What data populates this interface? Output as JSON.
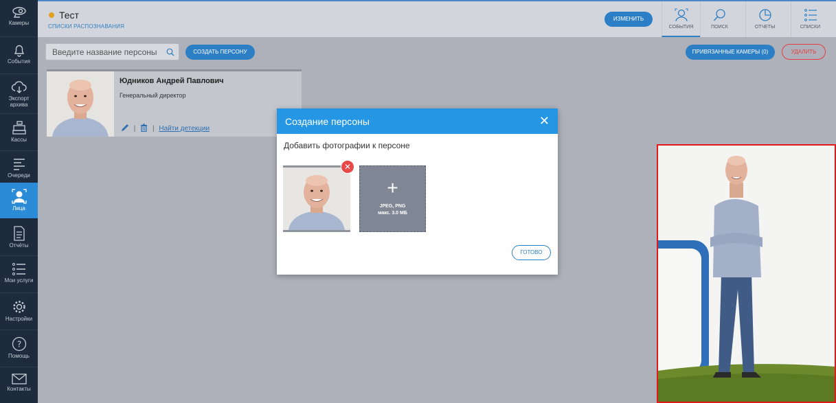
{
  "sidebar": {
    "items": [
      {
        "label": "Камеры",
        "icon": "camera-icon"
      },
      {
        "label": "События",
        "icon": "bell-icon"
      },
      {
        "label": "Экспорт архива",
        "icon": "cloud-download-icon"
      },
      {
        "label": "Кассы",
        "icon": "cash-register-icon"
      },
      {
        "label": "Очереди",
        "icon": "queue-icon"
      },
      {
        "label": "Лица",
        "icon": "face-icon"
      },
      {
        "label": "Отчёты",
        "icon": "document-icon"
      },
      {
        "label": "Мои услуги",
        "icon": "list-icon"
      },
      {
        "label": "Настройки",
        "icon": "gear-icon"
      },
      {
        "label": "Помощь",
        "icon": "help-icon"
      },
      {
        "label": "Контакты",
        "icon": "mail-icon"
      }
    ],
    "active": "Лица"
  },
  "header": {
    "title": "Тест",
    "breadcrumb": "Списки распознавания",
    "edit_button": "Изменить",
    "tabs": [
      {
        "label": "События",
        "icon": "person-icon"
      },
      {
        "label": "Поиск",
        "icon": "search-icon"
      },
      {
        "label": "Отчеты",
        "icon": "pie-chart-icon"
      },
      {
        "label": "Списки",
        "icon": "list-icon"
      }
    ],
    "active_tab": "События"
  },
  "toolbar": {
    "search_placeholder": "Введите название персоны",
    "create_button": "Создать персону",
    "linked_cameras_button": "Привязанные камеры (0)",
    "delete_button": "Удалить"
  },
  "person_card": {
    "name": "Юдников Андрей Павлович",
    "role": "Генеральный директор",
    "find_link": "Найти детекции"
  },
  "modal": {
    "title": "Создание персоны",
    "subtitle": "Добавить фотографии к персоне",
    "upload_formats": "JPEG, PNG",
    "upload_limit": "макс. 3.0 МБ",
    "done_button": "Готово"
  },
  "colors": {
    "accent": "#2c7fc4",
    "modal_header": "#2596e3",
    "sidebar": "#1d2b3c",
    "danger": "#e04040",
    "preview_border": "#e3171c"
  }
}
